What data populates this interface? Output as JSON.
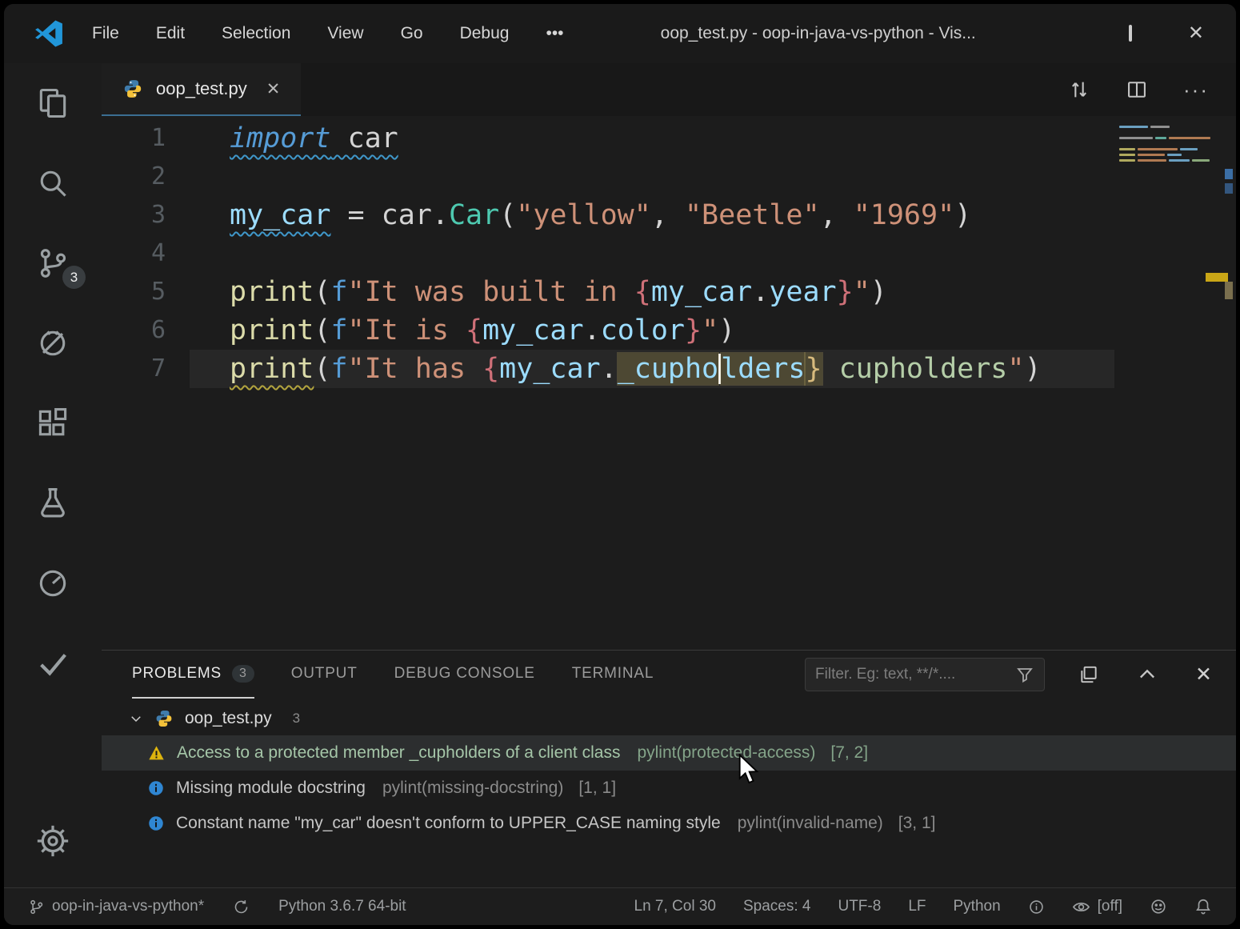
{
  "titlebar": {
    "title": "oop_test.py - oop-in-java-vs-python - Vis...",
    "menus": [
      "File",
      "Edit",
      "Selection",
      "View",
      "Go",
      "Debug",
      "•••"
    ]
  },
  "activity": {
    "scm_badge": "3"
  },
  "tab": {
    "label": "oop_test.py",
    "close": "✕"
  },
  "colors": {
    "warning": "#ddb40e",
    "info": "#2f86d2",
    "python_blue": "#3f7cac",
    "python_yellow": "#f3c13a",
    "vscode_blue": "#2196d9"
  },
  "code": {
    "lines": [
      {
        "num": "1",
        "tokens": [
          [
            "imp sq-info",
            "import"
          ],
          [
            "plain sq-info",
            " car"
          ]
        ]
      },
      {
        "num": "2",
        "tokens": []
      },
      {
        "num": "3",
        "tokens": [
          [
            "var sq-info",
            "my_car"
          ],
          [
            "plain",
            " = "
          ],
          [
            "plain",
            "car"
          ],
          [
            "plain",
            "."
          ],
          [
            "cls",
            "Car"
          ],
          [
            "plain",
            "("
          ],
          [
            "str",
            "\"yellow\""
          ],
          [
            "plain",
            ", "
          ],
          [
            "str",
            "\"Beetle\""
          ],
          [
            "plain",
            ", "
          ],
          [
            "str",
            "\"1969\""
          ],
          [
            "plain",
            ")"
          ]
        ]
      },
      {
        "num": "4",
        "tokens": []
      },
      {
        "num": "5",
        "tokens": [
          [
            "fn",
            "print"
          ],
          [
            "plain",
            "("
          ],
          [
            "fkw",
            "f"
          ],
          [
            "str",
            "\"It was built in "
          ],
          [
            "brace",
            "{"
          ],
          [
            "var",
            "my_car"
          ],
          [
            "plain",
            "."
          ],
          [
            "var",
            "year"
          ],
          [
            "brace",
            "}"
          ],
          [
            "str",
            "\""
          ],
          [
            "plain",
            ")"
          ]
        ]
      },
      {
        "num": "6",
        "tokens": [
          [
            "fn",
            "print"
          ],
          [
            "plain",
            "("
          ],
          [
            "fkw",
            "f"
          ],
          [
            "str",
            "\"It is "
          ],
          [
            "brace",
            "{"
          ],
          [
            "var",
            "my_car"
          ],
          [
            "plain",
            "."
          ],
          [
            "var",
            "color"
          ],
          [
            "brace",
            "}"
          ],
          [
            "str",
            "\""
          ],
          [
            "plain",
            ")"
          ]
        ]
      },
      {
        "num": "7",
        "current": true,
        "tokens": [
          [
            "fn sq-warn",
            "print"
          ],
          [
            "plain",
            "("
          ],
          [
            "fkw",
            "f"
          ],
          [
            "str",
            "\"It has "
          ],
          [
            "brace",
            "{"
          ],
          [
            "var",
            "my_car"
          ],
          [
            "plain",
            "."
          ],
          [
            "var hl",
            "_cupho"
          ],
          [
            "caret",
            ""
          ],
          [
            "var hl",
            "lders"
          ],
          [
            "brace2 hl",
            "}"
          ],
          [
            "str2",
            " cupholders"
          ],
          [
            "str",
            "\""
          ],
          [
            "plain",
            ")"
          ]
        ]
      }
    ]
  },
  "panel": {
    "tabs": [
      {
        "label": "PROBLEMS",
        "badge": "3",
        "active": true
      },
      {
        "label": "OUTPUT"
      },
      {
        "label": "DEBUG CONSOLE"
      },
      {
        "label": "TERMINAL"
      }
    ],
    "filter_placeholder": "Filter. Eg: text, **/*....",
    "file_group": {
      "name": "oop_test.py",
      "count": "3"
    },
    "problems": [
      {
        "severity": "warning",
        "message": "Access to a protected member _cupholders of a client class",
        "source": "pylint(protected-access)",
        "position": "[7, 2]",
        "selected": true
      },
      {
        "severity": "info",
        "message": "Missing module docstring",
        "source": "pylint(missing-docstring)",
        "position": "[1, 1]"
      },
      {
        "severity": "info",
        "message": "Constant name \"my_car\" doesn't conform to UPPER_CASE naming style",
        "source": "pylint(invalid-name)",
        "position": "[3, 1]"
      }
    ]
  },
  "statusbar": {
    "branch": "oop-in-java-vs-python*",
    "interpreter": "Python 3.6.7 64-bit",
    "cursor": "Ln 7, Col 30",
    "indent": "Spaces: 4",
    "encoding": "UTF-8",
    "eol": "LF",
    "language": "Python",
    "coverage": "[off]"
  }
}
